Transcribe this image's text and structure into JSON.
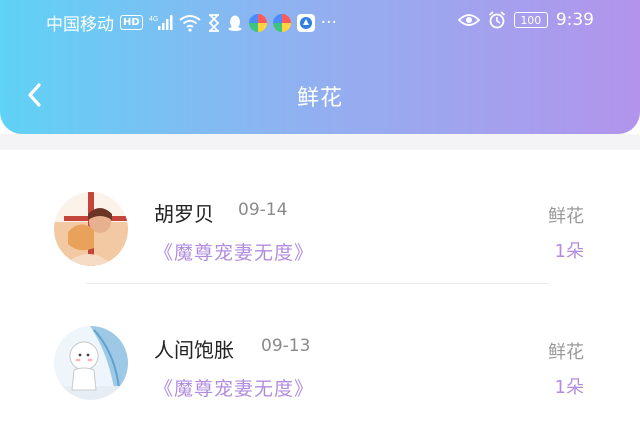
{
  "status_bar": {
    "carrier": "中国移动",
    "hd_label": "HD",
    "network_label": "4G",
    "battery_level": "100",
    "time": "9:39"
  },
  "nav": {
    "back_icon": "chevron-left-icon",
    "title": "鲜花"
  },
  "flower_records": [
    {
      "user_name": "胡罗贝",
      "date": "09-14",
      "book_title": "《魔尊宠妻无度》",
      "gift_type": "鲜花",
      "quantity": "1朵"
    },
    {
      "user_name": "人间饱胀",
      "date": "09-13",
      "book_title": "《魔尊宠妻无度》",
      "gift_type": "鲜花",
      "quantity": "1朵"
    }
  ],
  "colors": {
    "header_gradient_start": "#5fd2f5",
    "header_gradient_end": "#b294ec",
    "accent_purple": "#b28ddf",
    "muted_gray": "#9a9a9a"
  }
}
